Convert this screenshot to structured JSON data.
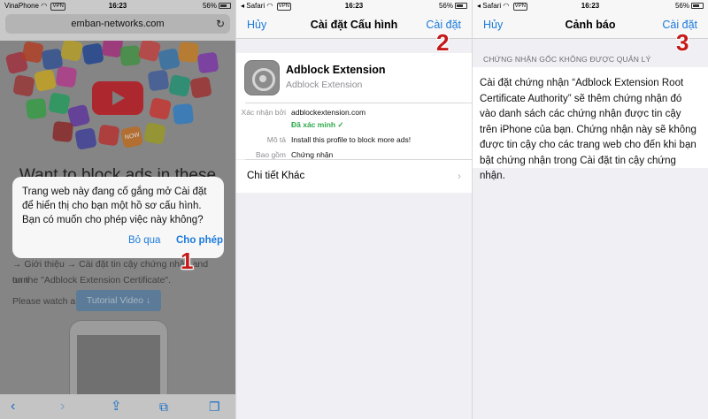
{
  "panel1": {
    "status": {
      "carrier": "VinaPhone",
      "time": "16:23",
      "battery": "56%",
      "vpn": "VPN"
    },
    "url": "emban-networks.com",
    "background": {
      "heading": "Want to block ads in these",
      "line1": "→ Giới thiệu → Cài đặt tin cậy chứng nhận and turn",
      "line2": "on the \"Adblock Extension Certificate\".",
      "watch": "Please watch a",
      "button": "Tutorial Video ↓",
      "app_label": "NOW"
    },
    "dialog": {
      "message": "Trang web này đang cố gắng mở Cài đặt để hiển thị cho bạn một hồ sơ cấu hình. Bạn có muốn cho phép việc này không?",
      "ignore": "Bỏ qua",
      "allow": "Cho phép"
    },
    "step": "1",
    "toolbar_icons": [
      "back-arrow-icon",
      "forward-arrow-icon",
      "share-icon",
      "bookmarks-icon",
      "tabs-icon"
    ]
  },
  "panel2": {
    "status": {
      "app": "Safari",
      "time": "16:23",
      "battery": "56%",
      "vpn": "VPN"
    },
    "nav": {
      "cancel": "Hủy",
      "title": "Cài đặt Cấu hình",
      "install": "Cài đặt"
    },
    "profile": {
      "name": "Adblock Extension",
      "sub": "Adblock Extension"
    },
    "details": {
      "signed_label": "Xác nhận bởi",
      "signed_value": "adblockextension.com",
      "verified": "Đã xác minh ✓",
      "desc_label": "Mô tả",
      "desc_value": "Install this profile to block more ads!",
      "contains_label": "Bao gồm",
      "contains_value": "Chứng nhận"
    },
    "more_details": "Chi tiết Khác",
    "step": "2"
  },
  "panel3": {
    "status": {
      "app": "Safari",
      "time": "16:23",
      "battery": "56%",
      "vpn": "VPN"
    },
    "nav": {
      "cancel": "Hủy",
      "title": "Cảnh báo",
      "install": "Cài đặt"
    },
    "section_header": "CHỨNG NHẬN GỐC KHÔNG ĐƯỢC QUẢN LÝ",
    "warning": "Cài đặt chứng nhận “Adblock Extension Root Certificate Authority” sẽ thêm chứng nhận đó vào danh sách các chứng nhận được tin cậy trên iPhone của bạn. Chứng nhận này sẽ không được tin cậy cho các trang web cho đến khi bạn bật chứng nhận trong Cài đặt tin cậy chứng nhận.",
    "step": "3"
  },
  "colors": {
    "ios_blue": "#1a7adc",
    "verified_green": "#2ea84a",
    "step_red": "#c41a1a"
  }
}
